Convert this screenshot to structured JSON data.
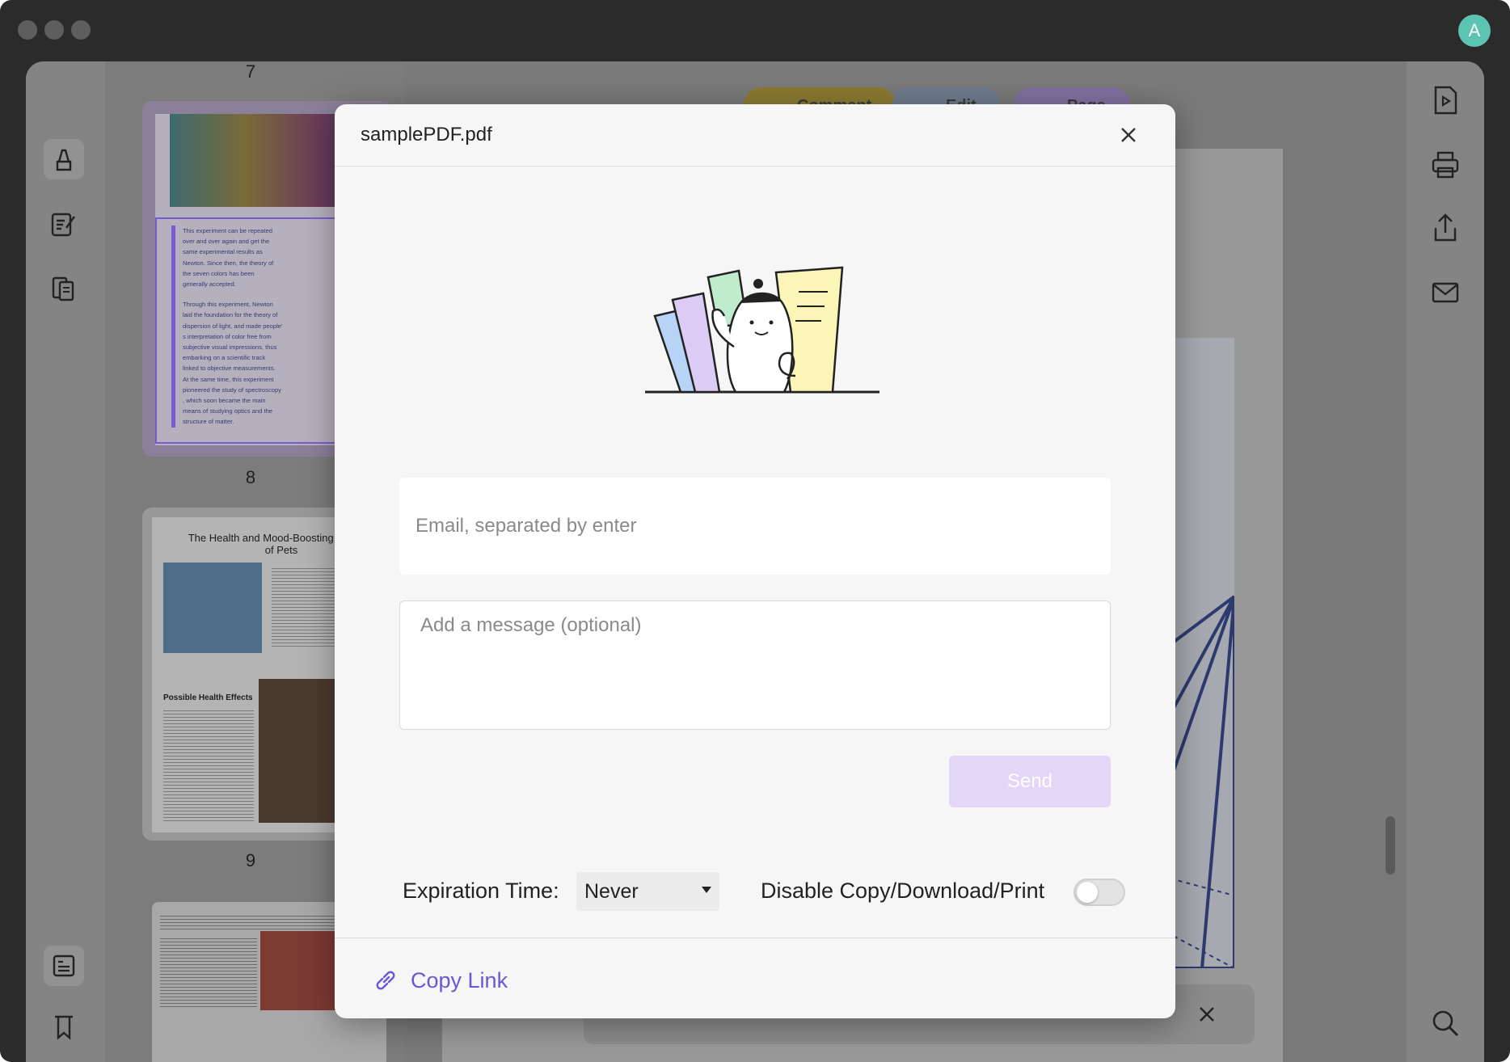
{
  "window": {
    "avatar_letter": "A",
    "thumbnail_page_numbers": [
      "7",
      "8",
      "9"
    ],
    "mode_buttons": [
      "Comment",
      "Edit",
      "Page"
    ]
  },
  "thumbnails": {
    "page8_lines": [
      "This experiment can be repeated",
      "over and over again and get the",
      "same experimental results as",
      "Newton. Since then, the theory of",
      "the seven colors has been",
      "generally accepted.",
      "",
      "Through this experiment, Newton",
      "laid the foundation for the theory of",
      "dispersion of light, and made people'",
      "s interpretation of color free from",
      "subjective visual impressions, thus",
      "embarking on a scientific track",
      "linked to objective measurements.",
      "At the same time, this experiment",
      "pioneered the study of spectroscopy",
      ", which soon became the main",
      "means of studying optics and the",
      "structure of matter."
    ],
    "page9_title": "The Health and Mood-Boosting Benefits of Pets",
    "page9_subheading": "Possible Health Effects"
  },
  "modal": {
    "title": "samplePDF.pdf",
    "email_placeholder": "Email, separated by enter",
    "message_placeholder": "Add a message (optional)",
    "send_label": "Send",
    "expiration_label": "Expiration Time:",
    "expiration_value": "Never",
    "disable_label": "Disable Copy/Download/Print",
    "disable_enabled": false,
    "copy_link_label": "Copy Link"
  },
  "colors": {
    "accent": "#6b56d6",
    "send_disabled_bg": "#e3d6f7",
    "avatar_bg": "#5bc4b2"
  },
  "icons": [
    "highlighter-icon",
    "edit-text-icon",
    "organize-pages-icon",
    "form-icon",
    "bookmark-icon",
    "play-slides-icon",
    "print-icon",
    "share-icon",
    "mail-icon",
    "search-icon",
    "close-icon",
    "link-icon"
  ]
}
